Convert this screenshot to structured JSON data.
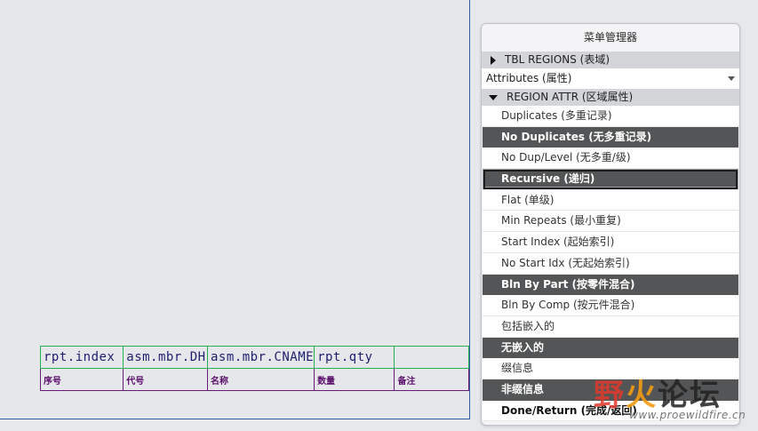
{
  "drawing": {
    "param_row": [
      "rpt.index",
      "asm.mbr.DH",
      "asm.mbr.CNAME",
      "rpt.qty",
      ""
    ],
    "header_row": [
      "序号",
      "代号",
      "名称",
      "数量",
      "备注"
    ]
  },
  "menu_manager": {
    "title": "菜单管理器",
    "tbl_regions_label": "TBL REGIONS (表域)",
    "attributes_select": "Attributes (属性)",
    "region_attr_label": "REGION ATTR (区域属性)",
    "items": [
      {
        "label": "Duplicates (多重记录)",
        "style": "normal"
      },
      {
        "label": "No Duplicates (无多重记录)",
        "style": "dark"
      },
      {
        "label": "No Dup/Level (无多重/级)",
        "style": "normal"
      },
      {
        "label": "Recursive (递归)",
        "style": "focused"
      },
      {
        "label": "Flat (单级)",
        "style": "normal"
      },
      {
        "label": "Min Repeats (最小重复)",
        "style": "normal"
      },
      {
        "label": "Start Index (起始索引)",
        "style": "normal"
      },
      {
        "label": "No Start Idx (无起始索引)",
        "style": "normal"
      },
      {
        "label": "Bln By Part (按零件混合)",
        "style": "dark"
      },
      {
        "label": "Bln By Comp (按元件混合)",
        "style": "normal"
      },
      {
        "label": "包括嵌入的",
        "style": "normal"
      },
      {
        "label": "无嵌入的",
        "style": "dark"
      },
      {
        "label": "缀信息",
        "style": "normal"
      },
      {
        "label": "非缀信息",
        "style": "dark"
      },
      {
        "label": "Done/Return (完成/返回)",
        "style": "bold"
      }
    ]
  },
  "watermark": {
    "main_1": "野",
    "main_2": "火",
    "main_3": "论坛",
    "url": "www.proewildfire.cn",
    "colors": {
      "red": "#e0392b",
      "orange": "#f39c12",
      "dark": "#222222"
    }
  },
  "colors": {
    "canvas_bg": "#e6e7eb",
    "canvas_border": "#2f5fa0",
    "param_border": "#22b14c",
    "header_border": "#6a1b7a",
    "menu_dark": "#545556"
  }
}
